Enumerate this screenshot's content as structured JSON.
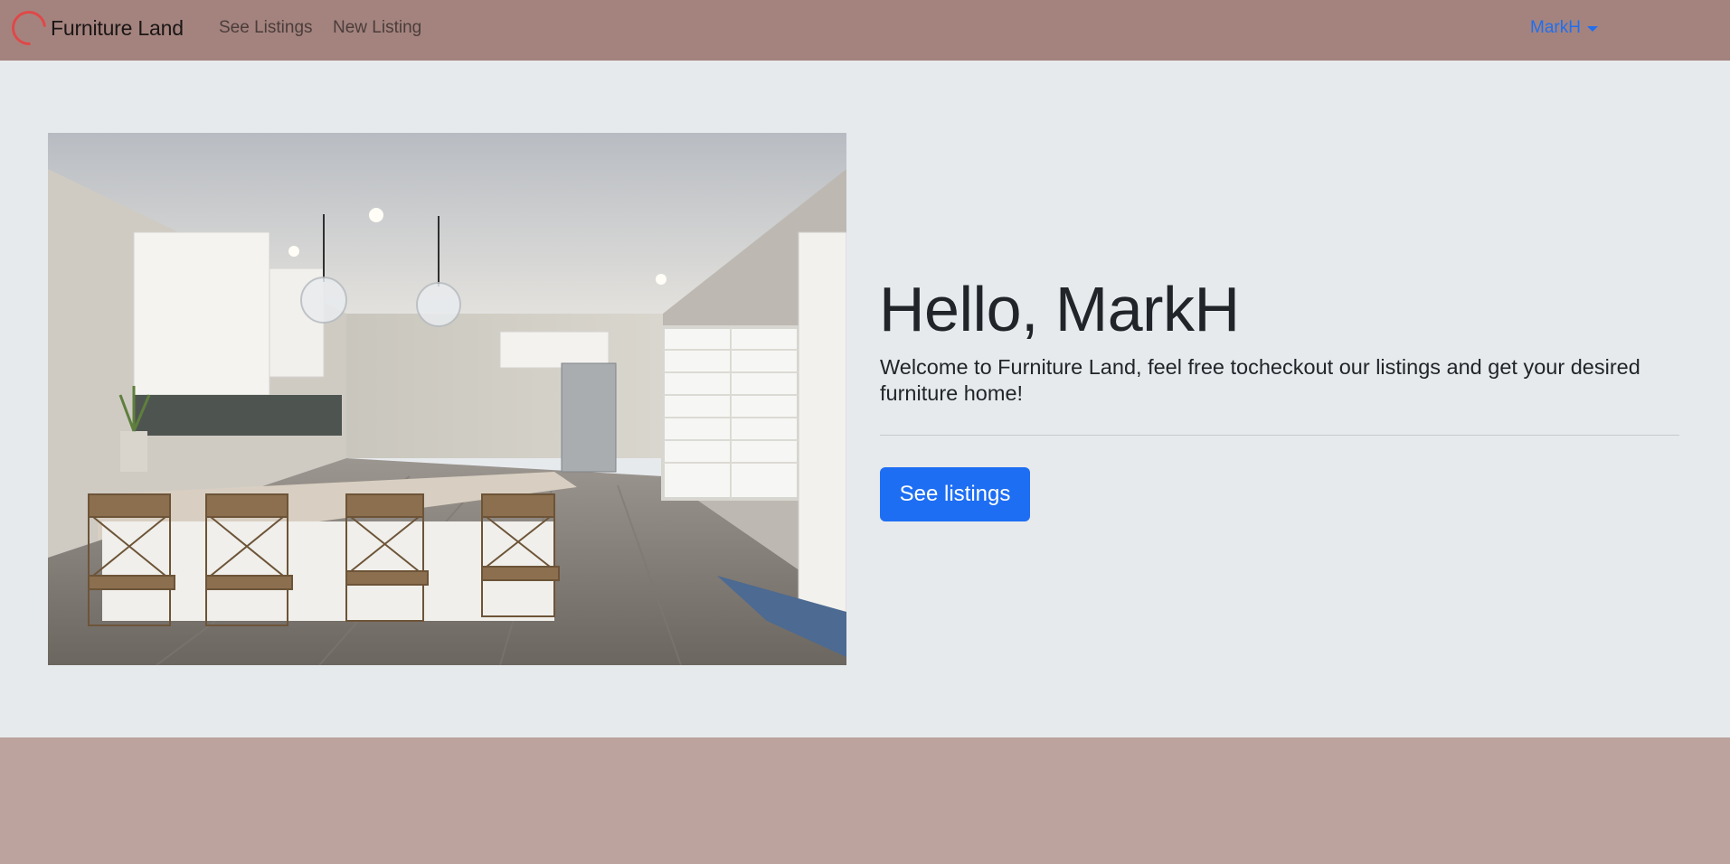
{
  "navbar": {
    "brand": "Furniture Land",
    "links": [
      "See Listings",
      "New Listing"
    ],
    "user": "MarkH"
  },
  "hero": {
    "title": "Hello, MarkH",
    "lead": "Welcome to Furniture Land, feel free tocheckout our listings and get your desired furniture home!",
    "button_label": "See listings",
    "image_icon": "kitchen-photo"
  },
  "colors": {
    "navbar_bg": "#a4837e",
    "hero_bg": "#e7eaed",
    "footer_bg": "#bca39e",
    "primary": "#1e6ef3",
    "logo": "#e04848"
  }
}
